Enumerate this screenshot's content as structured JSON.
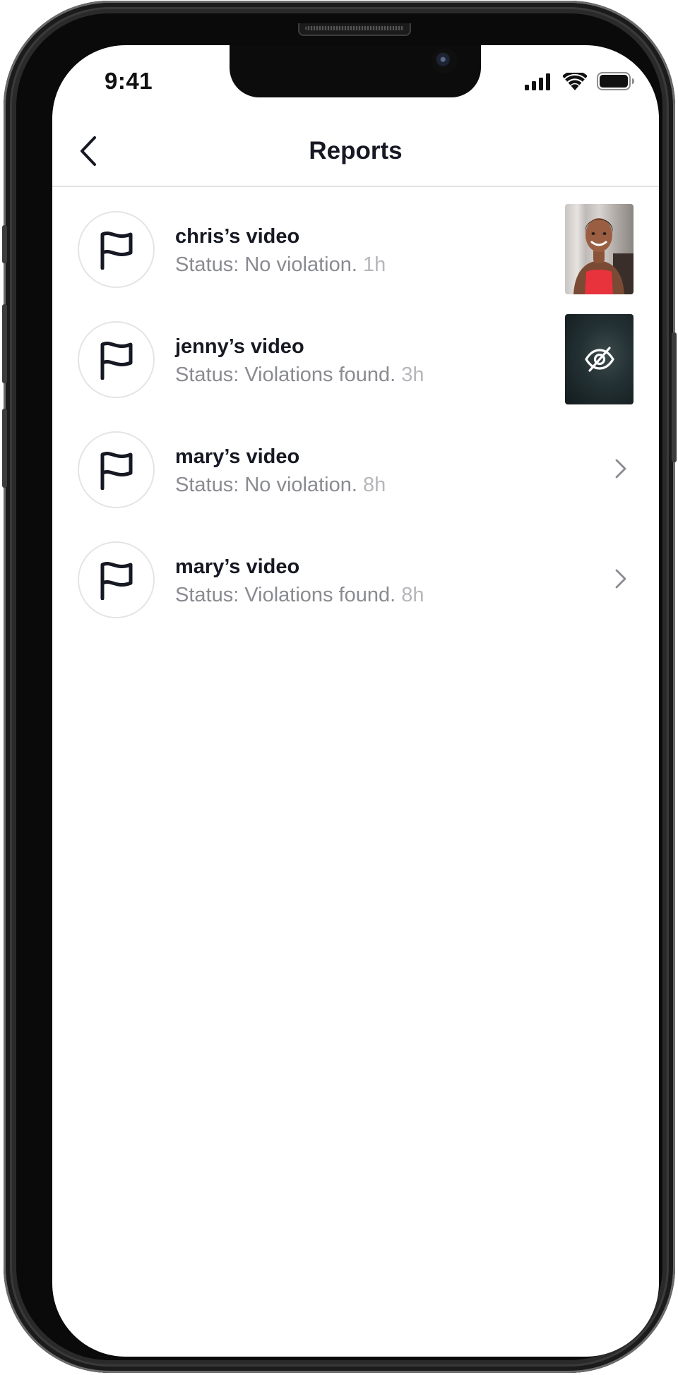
{
  "status_bar": {
    "time": "9:41"
  },
  "header": {
    "title": "Reports",
    "back_icon": "chevron-left-icon"
  },
  "reports": [
    {
      "title": "chris’s video",
      "status_text": "Status: No violation.",
      "time": "1h",
      "preview": "thumbnail"
    },
    {
      "title": "jenny’s video",
      "status_text": "Status: Violations found.",
      "time": "3h",
      "preview": "hidden-thumbnail"
    },
    {
      "title": "mary’s video",
      "status_text": "Status: No violation.",
      "time": "8h",
      "preview": "chevron"
    },
    {
      "title": "mary’s video",
      "status_text": "Status: Violations found.",
      "time": "8h",
      "preview": "chevron"
    }
  ],
  "icons": {
    "row_icon": "flag-icon",
    "hidden_icon": "eye-off-icon",
    "row_action": "chevron-right-icon"
  },
  "colors": {
    "title_text": "#161823",
    "secondary_text": "#8a8b91",
    "time_text": "#b6b7bb",
    "divider": "#e3e3e3"
  }
}
